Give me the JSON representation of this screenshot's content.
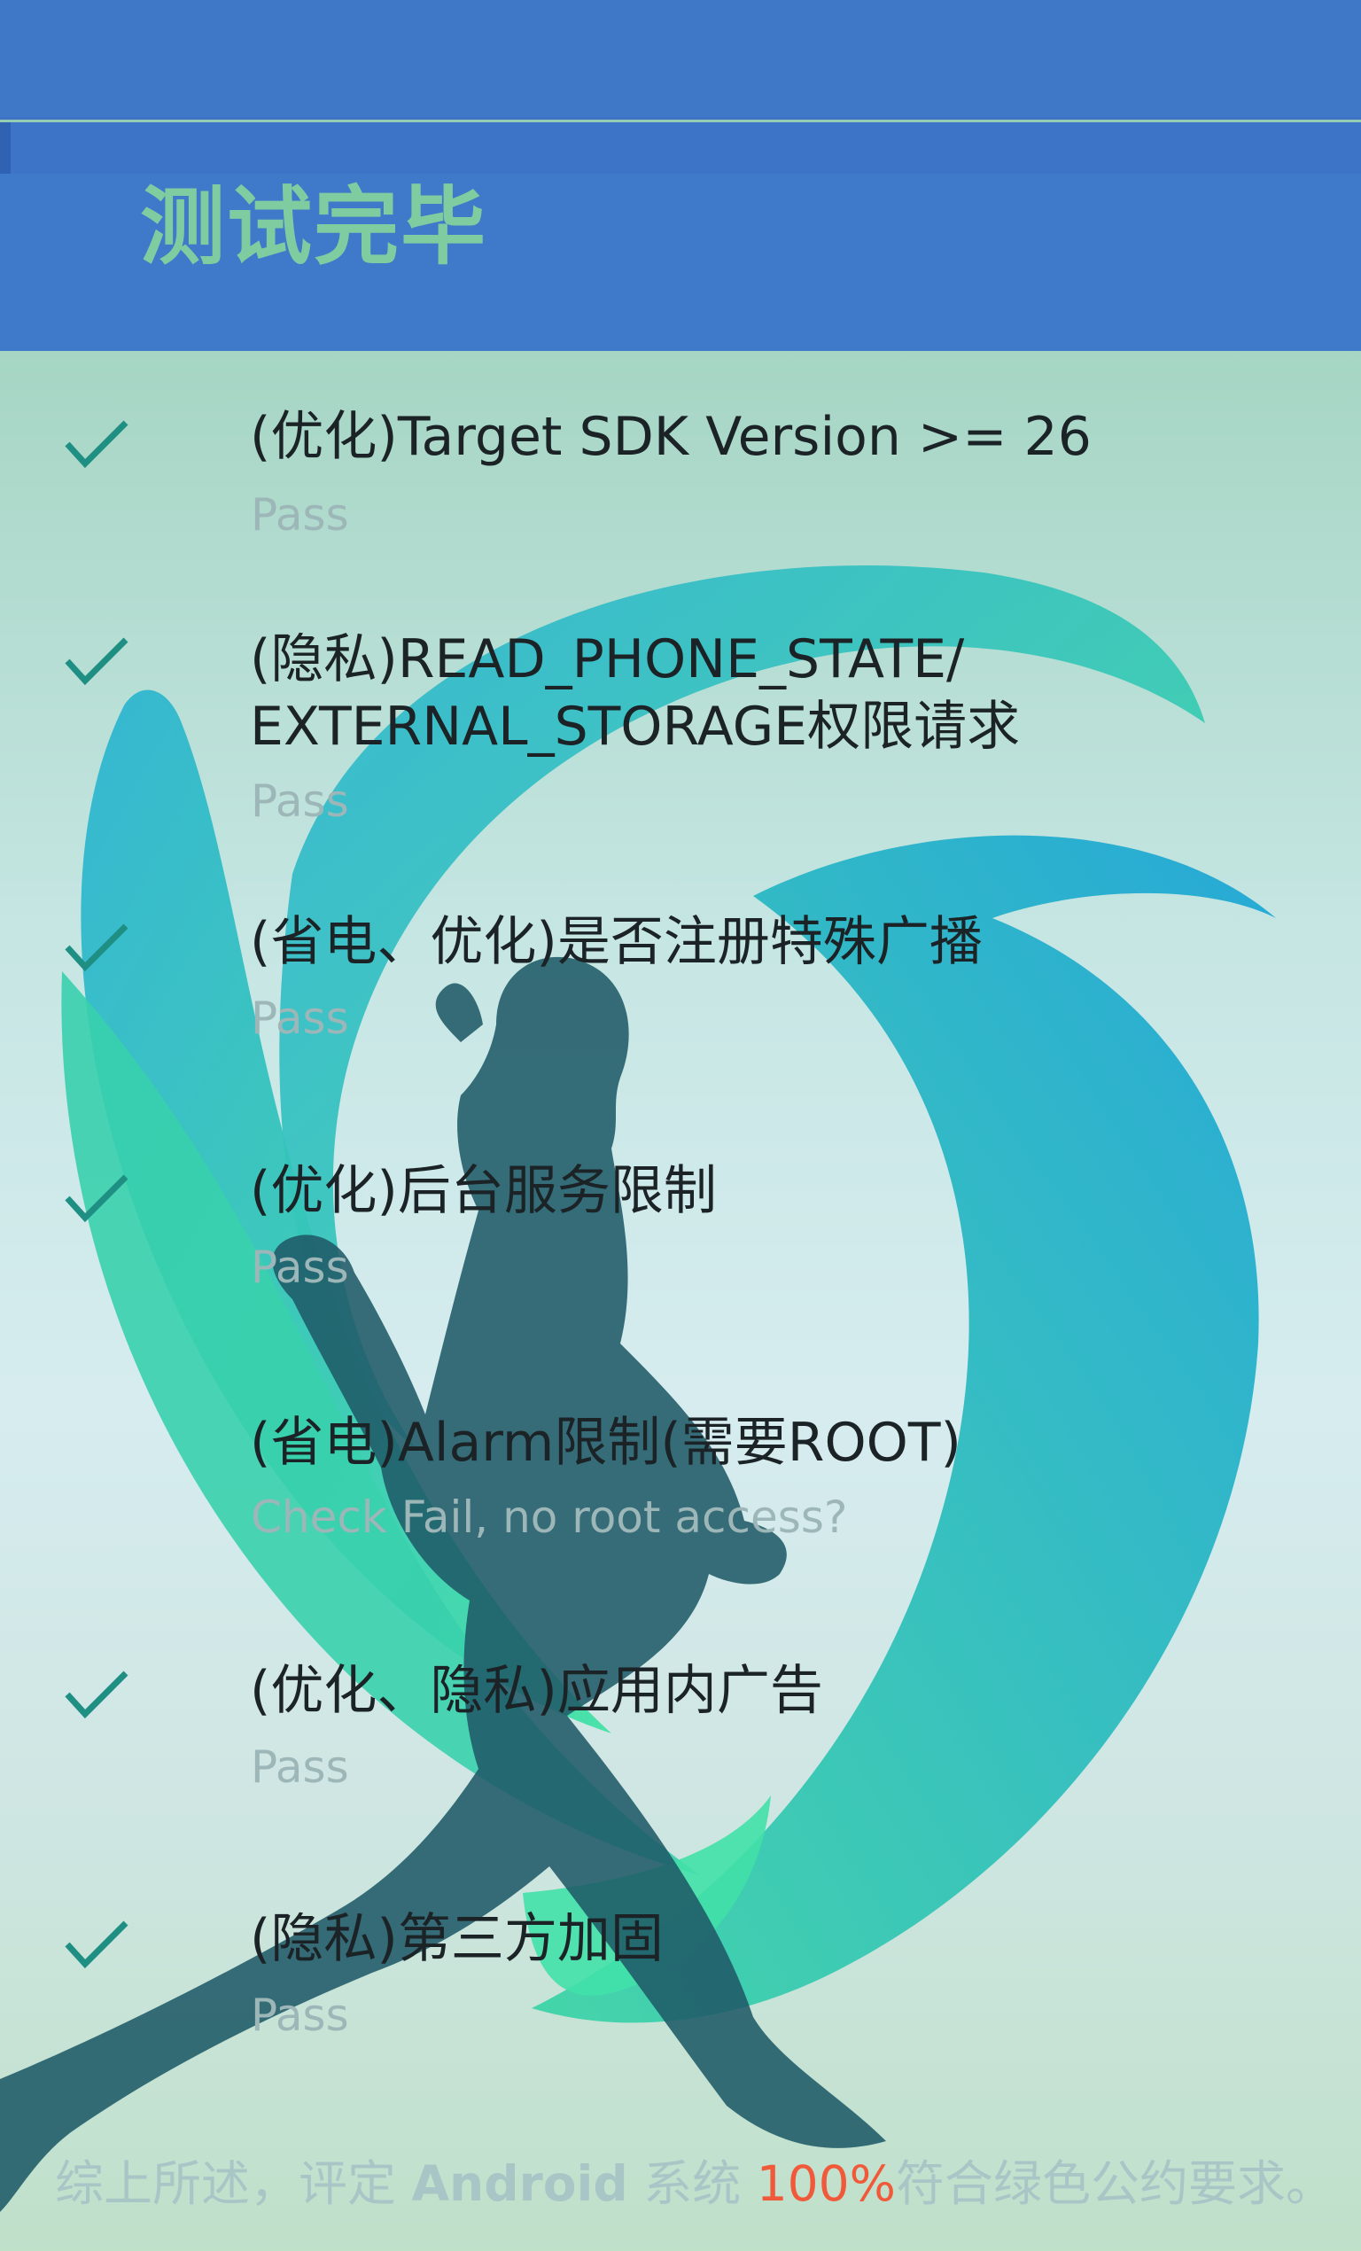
{
  "app": {
    "title": "测试完毕"
  },
  "items": [
    {
      "title": "(优化)Target SDK Version >= 26",
      "status": "Pass",
      "icon": "check-icon",
      "checked": true
    },
    {
      "title": "(隐私)READ_PHONE_STATE/\nEXTERNAL_STORAGE权限请求",
      "status": "Pass",
      "icon": "check-icon",
      "checked": true
    },
    {
      "title": "(省电、优化)是否注册特殊广播",
      "status": "Pass",
      "icon": "check-icon",
      "checked": true
    },
    {
      "title": "(优化)后台服务限制",
      "status": "Pass",
      "icon": "check-icon",
      "checked": true
    },
    {
      "title": "(省电)Alarm限制(需要ROOT)",
      "status": "Check Fail, no root access?",
      "checked": false
    },
    {
      "title": "(优化、隐私)应用内广告",
      "status": "Pass",
      "icon": "check-icon",
      "checked": true
    },
    {
      "title": "(隐私)第三方加固",
      "status": "Pass",
      "icon": "check-icon",
      "checked": true
    }
  ],
  "footer": {
    "prefix": "综上所述，评定 ",
    "brand": "Android",
    "middle": " 系统 ",
    "percent": "100%",
    "suffix": "符合绿色公约要求。"
  },
  "colors": {
    "toolbar": "#3f79c9",
    "title": "#7fcca1",
    "check": "#1f8f83",
    "percent": "#f05a3a"
  }
}
